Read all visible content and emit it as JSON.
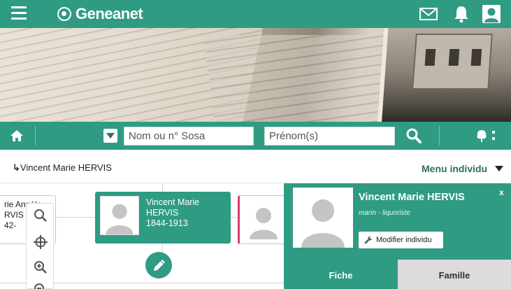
{
  "topbar": {
    "brand": "Geneanet",
    "icons": [
      "menu-icon",
      "mail-icon",
      "bell-icon",
      "user-icon"
    ]
  },
  "search": {
    "sosa_placeholder": "Nom ou n° Sosa",
    "prenom_placeholder": "Prénom(s)",
    "icons": [
      "home-icon",
      "dropdown-icon",
      "search-icon",
      "tree-icon"
    ]
  },
  "breadcrumb": {
    "arrow": "↳",
    "person": "Vincent Marie HERVIS",
    "menu_label": "Menu individu"
  },
  "tree": {
    "left_card": {
      "line1": "rie Angèle",
      "line2": "RVIS",
      "line3": "42-"
    },
    "main_card": {
      "first_names": "Vincent Marie",
      "surname": "HERVIS",
      "dates": "1844-1913"
    }
  },
  "panel": {
    "name": "Vincent Marie HERVIS",
    "occupation": "marin - liquoriste",
    "close": "x",
    "modify_label": "Modifier individu",
    "tabs": [
      {
        "label": "Fiche",
        "active": true
      },
      {
        "label": "Famille",
        "active": false
      }
    ]
  },
  "colors": {
    "brand": "#2f9b83",
    "inactive_tab": "#dcdcdc",
    "female_marker": "#e33a6a"
  }
}
